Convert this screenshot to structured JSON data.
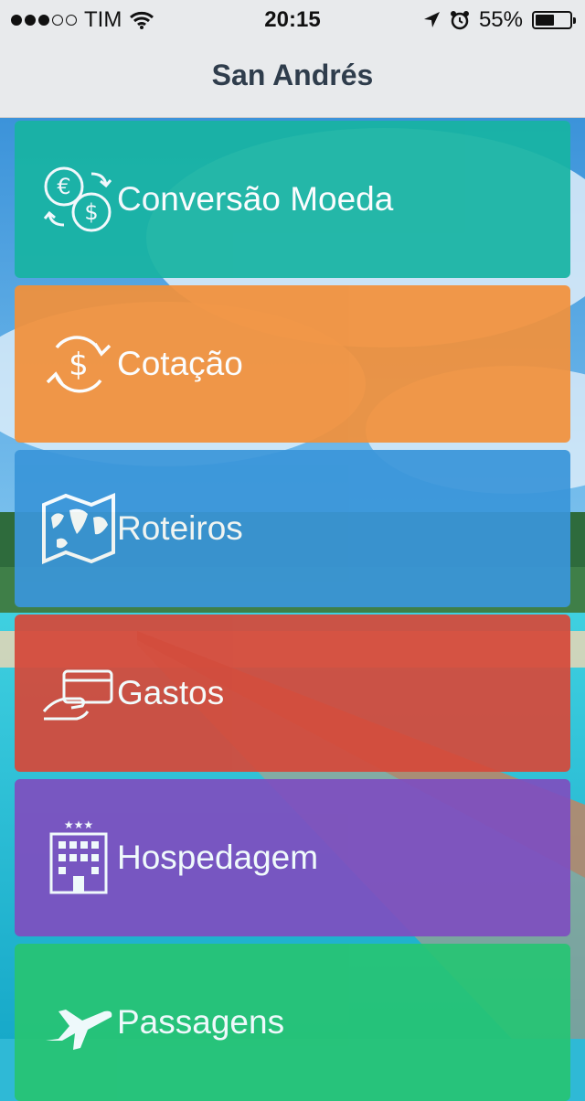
{
  "status_bar": {
    "carrier": "TIM",
    "time": "20:15",
    "battery_percent": "55%",
    "battery_level": 0.55,
    "signal_bars_filled": 3,
    "signal_bars_total": 5
  },
  "nav": {
    "title": "San Andrés"
  },
  "menu": {
    "items": [
      {
        "label": "Conversão Moeda",
        "icon": "currency-exchange-icon",
        "color": "#18b4a3"
      },
      {
        "label": "Cotação",
        "icon": "dollar-refresh-icon",
        "color": "#f2913b"
      },
      {
        "label": "Roteiros",
        "icon": "map-icon",
        "color": "#3a96d9"
      },
      {
        "label": "Gastos",
        "icon": "credit-card-hand-icon",
        "color": "#d5493a"
      },
      {
        "label": "Hospedagem",
        "icon": "hotel-icon",
        "color": "#7e4fc0"
      },
      {
        "label": "Passagens",
        "icon": "airplane-icon",
        "color": "#27c474"
      }
    ]
  }
}
